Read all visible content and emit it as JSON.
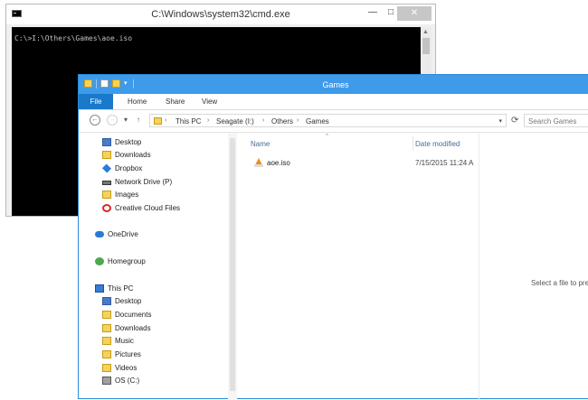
{
  "cmd": {
    "title": "C:\\Windows\\system32\\cmd.exe",
    "minimize": "—",
    "maximize": "□",
    "close": "✕",
    "prompt_line": "C:\\>I:\\Others\\Games\\aoe.iso"
  },
  "explorer": {
    "title": "Games",
    "ribbon_tabs": [
      "File",
      "Home",
      "Share",
      "View"
    ],
    "address": {
      "crumbs": [
        "This PC",
        "Seagate (I:)",
        "Others",
        "Games"
      ]
    },
    "search_placeholder": "Search Games",
    "nav": {
      "favorites": [
        "Desktop",
        "Downloads",
        "Dropbox",
        "Network Drive (P)",
        "Images",
        "Creative Cloud Files"
      ],
      "onedrive": "OneDrive",
      "homegroup": "Homegroup",
      "thispc": "This PC",
      "thispc_items": [
        "Desktop",
        "Documents",
        "Downloads",
        "Music",
        "Pictures",
        "Videos",
        "OS (C:)"
      ]
    },
    "columns": {
      "name": "Name",
      "date": "Date modified"
    },
    "files": [
      {
        "name": "aoe.iso",
        "date": "7/15/2015 11:24 A"
      }
    ],
    "preview_text": "Select a file to pre"
  }
}
